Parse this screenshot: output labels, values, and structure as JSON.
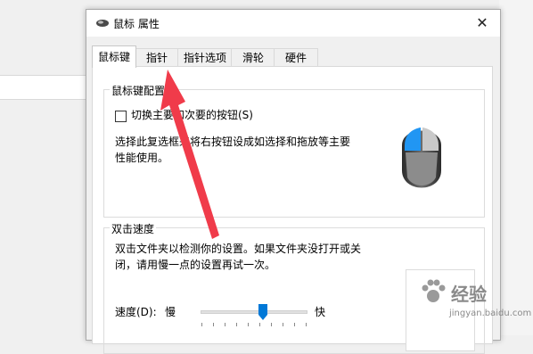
{
  "window": {
    "title": "鼠标 属性",
    "close_symbol": "✕"
  },
  "tabs": [
    {
      "label": "鼠标键",
      "active": true
    },
    {
      "label": "指针",
      "active": false
    },
    {
      "label": "指针选项",
      "active": false
    },
    {
      "label": "滑轮",
      "active": false
    },
    {
      "label": "硬件",
      "active": false
    }
  ],
  "button_config": {
    "group_label": "鼠标键配置",
    "checkbox_label": "切换主要和次要的按钮(S)",
    "checked": false,
    "description_line1": "选择此复选框来将右按钮设成如选择和拖放等主要",
    "description_line2": "性能使用。"
  },
  "double_click": {
    "group_label": "双击速度",
    "description_line1": "双击文件夹以检测你的设置。如果文件夹没打开或关",
    "description_line2": "闭，请用慢一点的设置再试一次。",
    "speed_label": "速度(D):",
    "slow_label": "慢",
    "fast_label": "快",
    "speed_value": 0.6
  },
  "watermark": {
    "text": "经验",
    "sub": "jingyan.baidu.com"
  },
  "colors": {
    "accent": "#0078d7",
    "annotation_arrow": "#f03b4a"
  },
  "icons": [
    "mouse-icon",
    "close-icon",
    "mouse-illustration"
  ]
}
